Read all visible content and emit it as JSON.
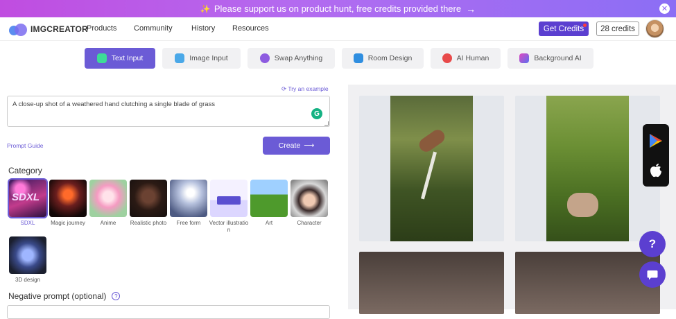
{
  "banner": {
    "text": "Please support us on product hunt, free credits provided there"
  },
  "nav": {
    "logo": "IMGCREATOR",
    "menu": [
      "Products",
      "Community",
      "History",
      "Resources"
    ],
    "get_credits": "Get Credits",
    "credits": "28 credits"
  },
  "tabs": [
    "Text Input",
    "Image Input",
    "Swap Anything",
    "Room Design",
    "AI Human",
    "Background AI"
  ],
  "form": {
    "try_example": "Try an example",
    "prompt_value": "A close-up shot of a weathered hand clutching a single blade of grass",
    "prompt_guide": "Prompt Guide",
    "create": "Create"
  },
  "category": {
    "title": "Category",
    "items": [
      "SDXL",
      "Magic journey",
      "Anime",
      "Realistic photo",
      "Free form",
      "Vector illustration",
      "Art",
      "Character",
      "3D design"
    ]
  },
  "negative": {
    "title": "Negative prompt (optional)"
  },
  "colors": {
    "accent": "#6b5bd6",
    "banner_start": "#c04de0",
    "banner_end": "#8b6ef5"
  }
}
